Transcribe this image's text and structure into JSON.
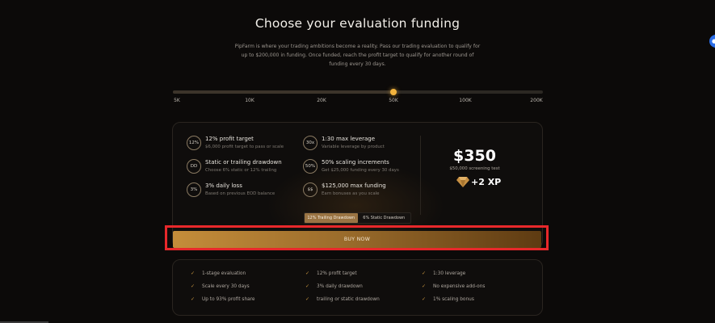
{
  "header": {
    "title": "Choose your evaluation funding",
    "subtitle": "PipFarm is where your trading ambitions become a reality. Pass our trading evaluation to qualify for up to $200,000 in funding. Once funded, reach the profit target to qualify for another round of funding every 30 days."
  },
  "slider": {
    "ticks": [
      "5K",
      "10K",
      "20K",
      "50K",
      "100K",
      "200K"
    ],
    "selected": "50K"
  },
  "features": [
    {
      "badge": "12%",
      "title": "12% profit target",
      "desc": "$6,000 profit target to pass or scale"
    },
    {
      "badge": "DD",
      "title": "Static or trailing drawdown",
      "desc": "Choose 6% static or 12% trailing"
    },
    {
      "badge": "3%",
      "title": "3% daily loss",
      "desc": "Based on previous EOD balance"
    },
    {
      "badge": "30x",
      "title": "1:30 max leverage",
      "desc": "Variable leverage by product"
    },
    {
      "badge": "50%",
      "title": "50% scaling increments",
      "desc": "Get $25,000 funding every 30 days"
    },
    {
      "badge": "$$",
      "title": "$125,000 max funding",
      "desc": "Earn bonuses as you scale"
    }
  ],
  "pricing": {
    "price": "$350",
    "price_sub": "$50,000 screening test",
    "xp": "+2 XP",
    "xp_icon": "diamond-icon"
  },
  "toggle": {
    "option_active": "12% Trailing Drawdown",
    "option_inactive": "6% Static Drawdown"
  },
  "cta": {
    "label": "BUY NOW"
  },
  "includes": [
    "1-stage evaluation",
    "12% profit target",
    "1:30 leverage",
    "Scale every 30 days",
    "3% daily drawdown",
    "No expensive add-ons",
    "Up to 93% profit share",
    "trailing or static drawdown",
    "1% scaling bonus"
  ],
  "colors": {
    "accent": "#f2b33d",
    "button_start": "#c48d3a",
    "button_end": "#5e3b12",
    "highlight": "#e8282b",
    "background": "#0c0a09"
  }
}
